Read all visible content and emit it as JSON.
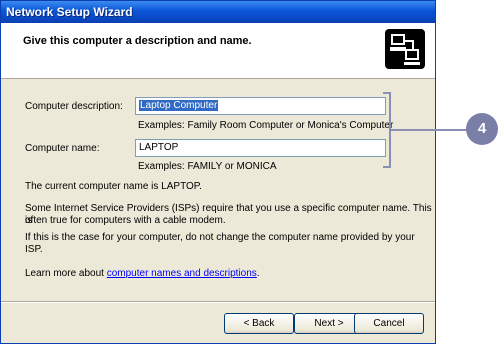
{
  "window": {
    "title": "Network Setup Wizard"
  },
  "header": {
    "title": "Give this computer a description and name.",
    "icon": "network-wizard-icon"
  },
  "form": {
    "description_label": "Computer description:",
    "description_value": "Laptop Computer",
    "description_examples": "Examples: Family Room Computer or Monica's Computer",
    "name_label": "Computer name:",
    "name_value": "LAPTOP",
    "name_examples": "Examples: FAMILY or MONICA"
  },
  "info": {
    "current_name": "The current computer name is LAPTOP.",
    "isp_line1": "Some Internet Service Providers (ISPs) require that you use a specific computer name. This is",
    "isp_line2": "often true for computers with a cable modem.",
    "isp_note": "If this is the case for your computer, do not change the computer name provided by your ISP.",
    "learn_prefix": "Learn more about ",
    "learn_link": "computer names and descriptions",
    "learn_suffix": "."
  },
  "buttons": {
    "back": "< Back",
    "next": "Next >",
    "cancel": "Cancel"
  },
  "callout": {
    "number": "4"
  },
  "colors": {
    "titlebar": "#0a55d6",
    "dialog_bg": "#ece9d8",
    "callout": "#7a7fa8",
    "link": "#0000ff"
  }
}
